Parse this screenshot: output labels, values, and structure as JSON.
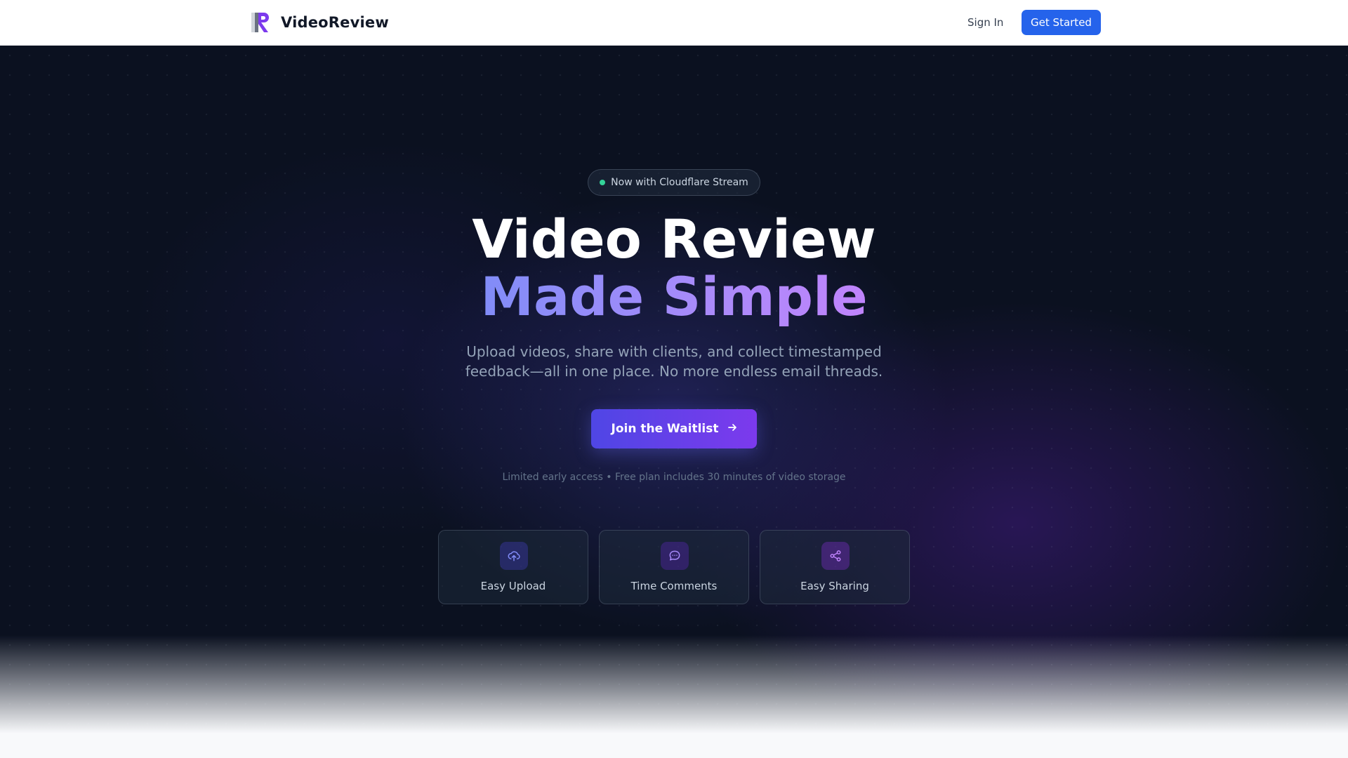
{
  "header": {
    "brand_name": "VideoReview",
    "nav": {
      "sign_in": "Sign In",
      "get_started": "Get Started"
    }
  },
  "hero": {
    "badge": "Now with Cloudflare Stream",
    "title_line1": "Video Review",
    "title_line2": "Made Simple",
    "subtitle": "Upload videos, share with clients, and collect timestamped feedback—all in one place. No more endless email threads.",
    "cta_label": "Join the Waitlist",
    "note": "Limited early access • Free plan includes 30 minutes of video storage"
  },
  "features": [
    {
      "label": "Easy Upload",
      "icon": "cloud-upload-icon"
    },
    {
      "label": "Time Comments",
      "icon": "chat-bubble-icon"
    },
    {
      "label": "Easy Sharing",
      "icon": "share-icon"
    }
  ],
  "colors": {
    "primary": "#2563eb",
    "cta_start": "#4f46e5",
    "cta_end": "#7c3aed",
    "hero_bg": "#0b1120",
    "badge_dot": "#34d399"
  }
}
